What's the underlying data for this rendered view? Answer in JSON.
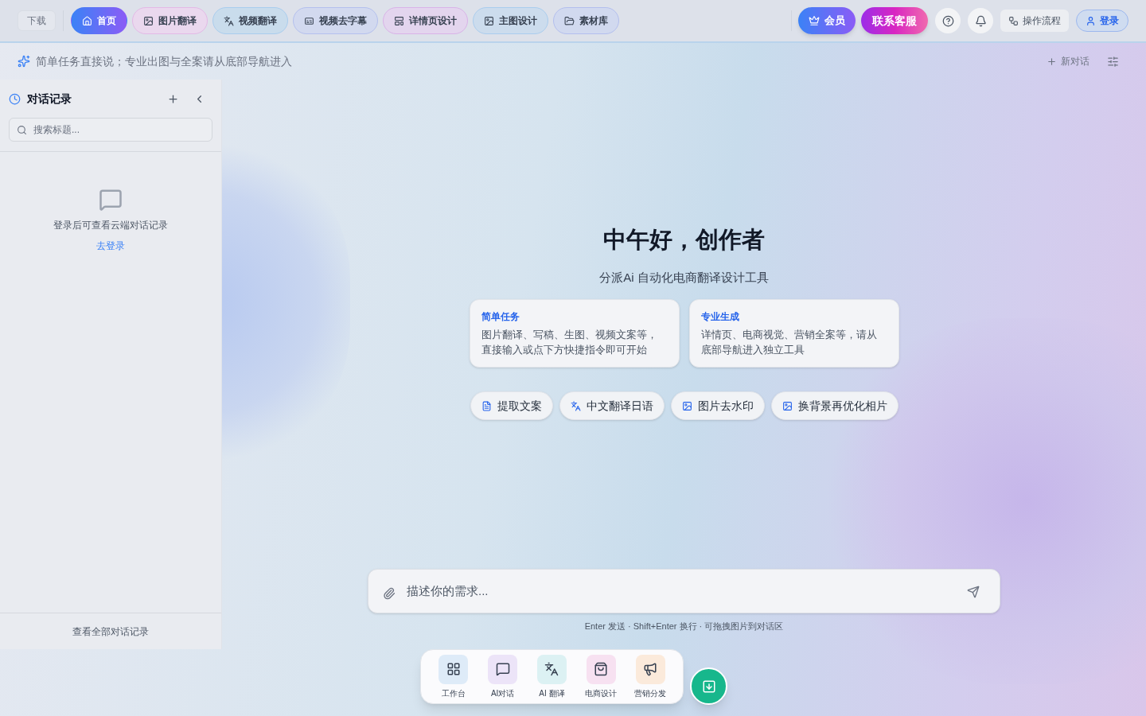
{
  "top_bar": {
    "download": "下载",
    "tabs": [
      {
        "label": "首页",
        "selected": true
      },
      {
        "label": "图片翻译",
        "selected": false
      },
      {
        "label": "视频翻译",
        "selected": false
      },
      {
        "label": "视频去字幕",
        "selected": false
      },
      {
        "label": "详情页设计",
        "selected": false
      },
      {
        "label": "主图设计",
        "selected": false
      },
      {
        "label": "素材库",
        "selected": false
      }
    ],
    "member": "会员",
    "contact": "联系客服",
    "workflow": "操作流程",
    "login": "登录"
  },
  "banner": {
    "hint": "简单任务直接说；专业出图与全案请从底部导航进入",
    "new_chat": "新对话"
  },
  "sidebar": {
    "title": "对话记录",
    "search": {
      "placeholder": "搜索标题..."
    },
    "empty_text": "登录后可查看云端对话记录",
    "login_link": "去登录",
    "footer": "查看全部对话记录"
  },
  "main": {
    "greeting": "中午好，创作者",
    "subtitle": "分派Ai 自动化电商翻译设计工具",
    "cards": [
      {
        "title": "简单任务",
        "text": "图片翻译、写稿、生图、视频文案等，直接输入或点下方快捷指令即可开始"
      },
      {
        "title": "专业生成",
        "text": "详情页、电商视觉、营销全案等，请从底部导航进入独立工具"
      }
    ],
    "quick_actions": [
      {
        "kind": "document",
        "label": "提取文案"
      },
      {
        "kind": "translate",
        "label": "中文翻译日语"
      },
      {
        "kind": "image",
        "label": "图片去水印"
      },
      {
        "kind": "image",
        "label": "换背景再优化相片"
      }
    ],
    "input": {
      "placeholder": "描述你的需求..."
    },
    "hint": "Enter 发送 · Shift+Enter 换行 · 可拖拽图片到对话区"
  },
  "dock": [
    {
      "kind": "workbench",
      "label": "工作台"
    },
    {
      "kind": "chat",
      "label": "AI对话"
    },
    {
      "kind": "translate",
      "label": "AI 翻译"
    },
    {
      "kind": "shop",
      "label": "电商设计"
    },
    {
      "kind": "megaphone",
      "label": "营销分发"
    }
  ]
}
